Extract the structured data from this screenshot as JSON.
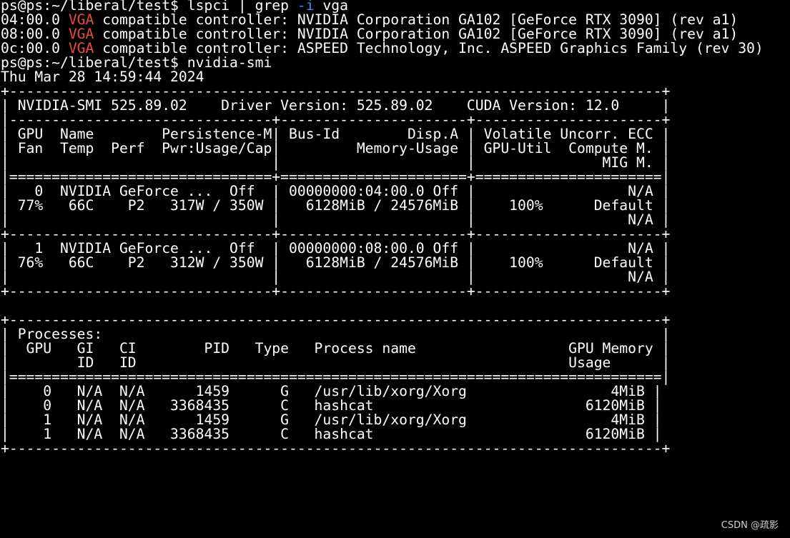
{
  "terminal": {
    "lines": [
      {
        "segments": [
          {
            "text": "ps@ps:~/liberal/test$ lspci | grep "
          },
          {
            "text": "-i",
            "style": "flag"
          },
          {
            "text": " vga"
          }
        ]
      },
      {
        "segments": [
          {
            "text": "04:00.0 "
          },
          {
            "text": "VGA",
            "style": "hl"
          },
          {
            "text": " compatible controller: NVIDIA Corporation GA102 [GeForce RTX 3090] (rev a1)"
          }
        ]
      },
      {
        "segments": [
          {
            "text": "08:00.0 "
          },
          {
            "text": "VGA",
            "style": "hl"
          },
          {
            "text": " compatible controller: NVIDIA Corporation GA102 [GeForce RTX 3090] (rev a1)"
          }
        ]
      },
      {
        "segments": [
          {
            "text": "0c:00.0 "
          },
          {
            "text": "VGA",
            "style": "hl"
          },
          {
            "text": " compatible controller: ASPEED Technology, Inc. ASPEED Graphics Family (rev 30)"
          }
        ]
      },
      {
        "segments": [
          {
            "text": "ps@ps:~/liberal/test$ nvidia-smi"
          }
        ]
      },
      {
        "segments": [
          {
            "text": "Thu Mar 28 14:59:44 2024"
          }
        ]
      },
      {
        "segments": [
          {
            "text": "+-----------------------------------------------------------------------------+"
          }
        ]
      },
      {
        "segments": [
          {
            "text": "| NVIDIA-SMI 525.89.02    Driver Version: 525.89.02    CUDA Version: 12.0     |"
          }
        ]
      },
      {
        "segments": [
          {
            "text": "|-------------------------------+----------------------+----------------------+"
          }
        ]
      },
      {
        "segments": [
          {
            "text": "| GPU  Name        Persistence-M| Bus-Id        Disp.A | Volatile Uncorr. ECC |"
          }
        ]
      },
      {
        "segments": [
          {
            "text": "| Fan  Temp  Perf  Pwr:Usage/Cap|         Memory-Usage | GPU-Util  Compute M. |"
          }
        ]
      },
      {
        "segments": [
          {
            "text": "|                               |                      |               MIG M. |"
          }
        ]
      },
      {
        "segments": [
          {
            "text": "|===============================+======================+======================|"
          }
        ]
      },
      {
        "segments": [
          {
            "text": "|   0  NVIDIA GeForce ...  Off  | 00000000:04:00.0 Off |                  N/A |"
          }
        ]
      },
      {
        "segments": [
          {
            "text": "| 77%   66C    P2   317W / 350W |   6128MiB / 24576MiB |    100%      Default |"
          }
        ]
      },
      {
        "segments": [
          {
            "text": "|                               |                      |                  N/A |"
          }
        ]
      },
      {
        "segments": [
          {
            "text": "+-------------------------------+----------------------+----------------------+"
          }
        ]
      },
      {
        "segments": [
          {
            "text": "|   1  NVIDIA GeForce ...  Off  | 00000000:08:00.0 Off |                  N/A |"
          }
        ]
      },
      {
        "segments": [
          {
            "text": "| 76%   66C    P2   312W / 350W |   6128MiB / 24576MiB |    100%      Default |"
          }
        ]
      },
      {
        "segments": [
          {
            "text": "|                               |                      |                  N/A |"
          }
        ]
      },
      {
        "segments": [
          {
            "text": "+-------------------------------+----------------------+----------------------+"
          }
        ]
      },
      {
        "segments": [
          {
            "text": " "
          }
        ]
      },
      {
        "segments": [
          {
            "text": "+-----------------------------------------------------------------------------+"
          }
        ]
      },
      {
        "segments": [
          {
            "text": "| Processes:                                                                  |"
          }
        ]
      },
      {
        "segments": [
          {
            "text": "|  GPU   GI   CI        PID   Type   Process name                  GPU Memory |"
          }
        ]
      },
      {
        "segments": [
          {
            "text": "|        ID   ID                                                   Usage      |"
          }
        ]
      },
      {
        "segments": [
          {
            "text": "|=============================================================================|"
          }
        ]
      },
      {
        "segments": [
          {
            "text": "|    0   N/A  N/A      1459      G   /usr/lib/xorg/Xorg                 4MiB |"
          }
        ]
      },
      {
        "segments": [
          {
            "text": "|    0   N/A  N/A   3368435      C   hashcat                         6120MiB |"
          }
        ]
      },
      {
        "segments": [
          {
            "text": "|    1   N/A  N/A      1459      G   /usr/lib/xorg/Xorg                 4MiB |"
          }
        ]
      },
      {
        "segments": [
          {
            "text": "|    1   N/A  N/A   3368435      C   hashcat                         6120MiB |"
          }
        ]
      },
      {
        "segments": [
          {
            "text": "+-----------------------------------------------------------------------------+"
          }
        ]
      }
    ]
  },
  "watermark": "CSDN @疏影"
}
